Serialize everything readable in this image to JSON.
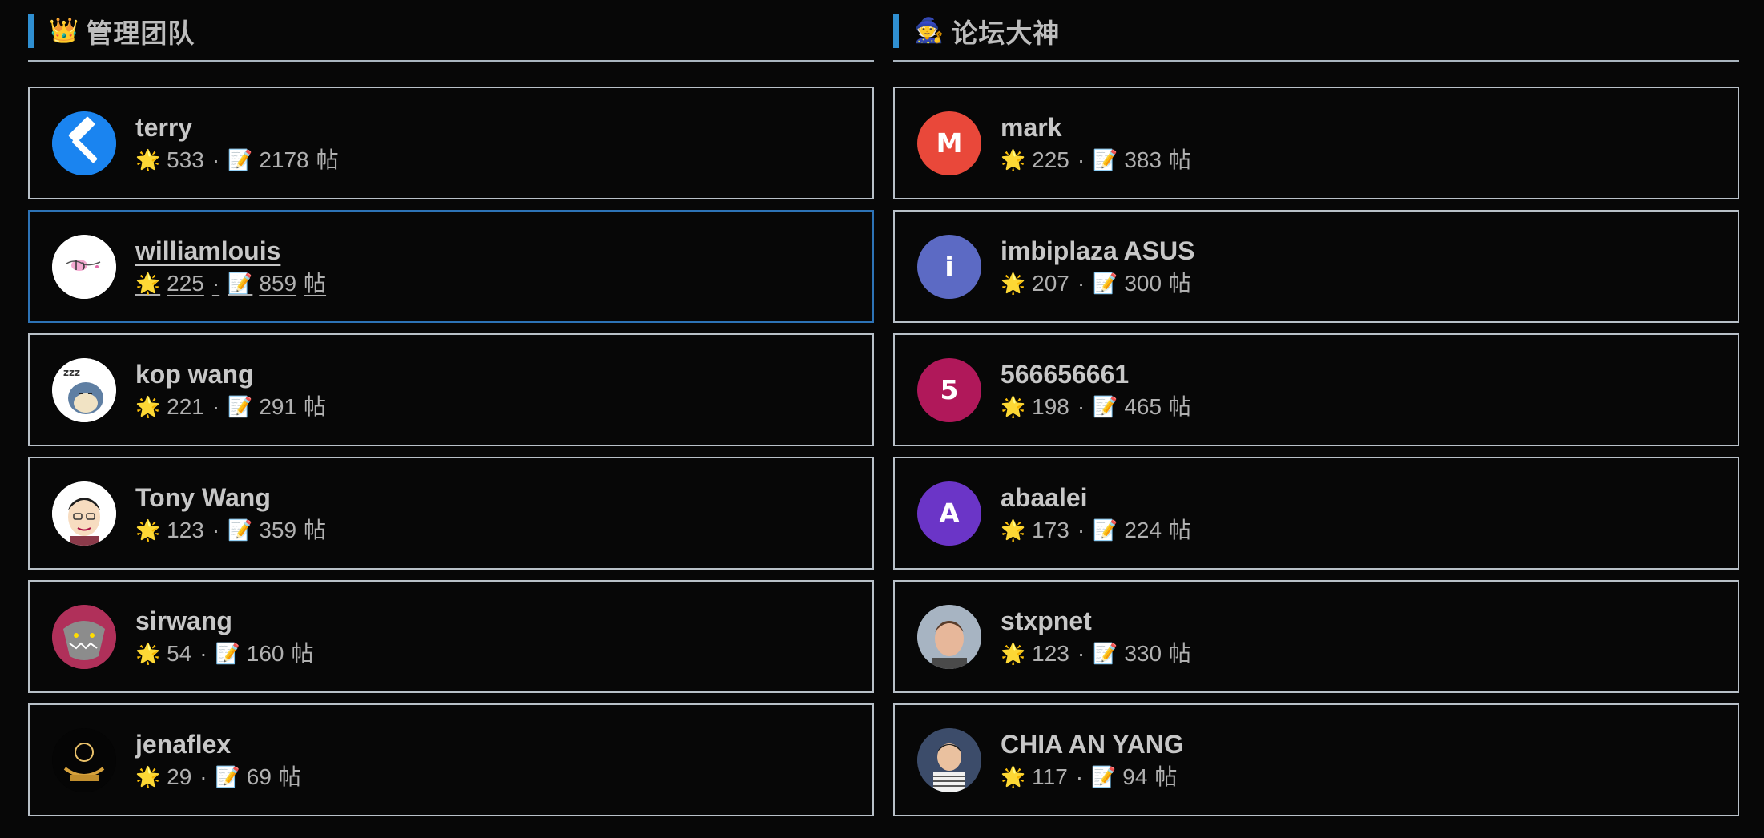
{
  "left_section": {
    "title": "管理团队",
    "icon": "crown-icon",
    "icon_glyph": "👑",
    "members": [
      {
        "name": "terry",
        "reputation": "533",
        "posts": "2178",
        "unit": "帖",
        "avatar_type": "hammer",
        "avatar_color": "#1a84f0",
        "active": false
      },
      {
        "name": "williamlouis",
        "reputation": "225",
        "posts": "859",
        "unit": "帖",
        "avatar_type": "sketch",
        "avatar_color": "#ffffff",
        "active": true
      },
      {
        "name": "kop wang",
        "reputation": "221",
        "posts": "291",
        "unit": "帖",
        "avatar_type": "snorlax",
        "avatar_color": "#ffffff",
        "active": false
      },
      {
        "name": "Tony Wang",
        "reputation": "123",
        "posts": "359",
        "unit": "帖",
        "avatar_type": "cartoon-face",
        "avatar_color": "#ffffff",
        "active": false
      },
      {
        "name": "sirwang",
        "reputation": "54",
        "posts": "160",
        "unit": "帖",
        "avatar_type": "beast",
        "avatar_color": "#b0305a",
        "active": false
      },
      {
        "name": "jenaflex",
        "reputation": "29",
        "posts": "69",
        "unit": "帖",
        "avatar_type": "emblem",
        "avatar_color": "#050505",
        "active": false
      }
    ]
  },
  "right_section": {
    "title": "论坛大神",
    "icon": "wizard-icon",
    "icon_glyph": "🧙",
    "members": [
      {
        "name": "mark",
        "reputation": "225",
        "posts": "383",
        "unit": "帖",
        "avatar_type": "letter",
        "avatar_letter": "M",
        "avatar_color": "#e9483a",
        "active": false
      },
      {
        "name": "imbiplaza ASUS",
        "reputation": "207",
        "posts": "300",
        "unit": "帖",
        "avatar_type": "letter",
        "avatar_letter": "i",
        "avatar_color": "#5c6ac4",
        "active": false
      },
      {
        "name": "566656661",
        "reputation": "198",
        "posts": "465",
        "unit": "帖",
        "avatar_type": "letter",
        "avatar_letter": "5",
        "avatar_color": "#b0185a",
        "active": false
      },
      {
        "name": "abaalei",
        "reputation": "173",
        "posts": "224",
        "unit": "帖",
        "avatar_type": "letter",
        "avatar_letter": "A",
        "avatar_color": "#6b35c7",
        "active": false
      },
      {
        "name": "stxpnet",
        "reputation": "123",
        "posts": "330",
        "unit": "帖",
        "avatar_type": "photo-man",
        "avatar_color": "#9aa8b8",
        "active": false
      },
      {
        "name": "CHIA AN YANG",
        "reputation": "117",
        "posts": "94",
        "unit": "帖",
        "avatar_type": "photo-boy",
        "avatar_color": "#3c4c6a",
        "active": false
      }
    ]
  },
  "stat_icons": {
    "reputation_icon": "sparkle-star-icon",
    "reputation_glyph": "🌟",
    "posts_icon": "memo-icon",
    "posts_glyph": "📝",
    "separator": "·"
  },
  "colors": {
    "background": "#070707",
    "accent_bar": "#2f8fd1",
    "card_border": "#b8c0c8",
    "active_border": "#2d73b6"
  }
}
